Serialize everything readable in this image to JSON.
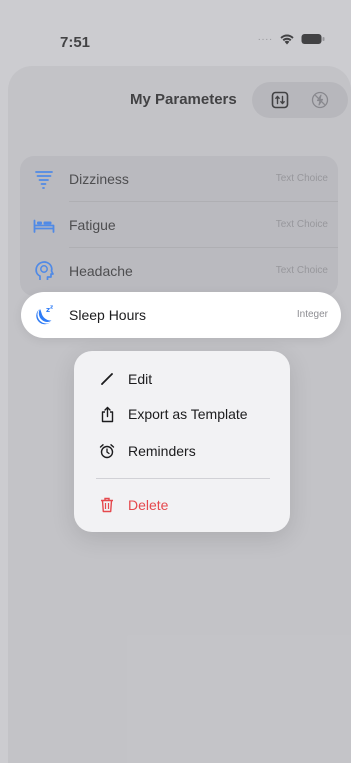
{
  "status": {
    "time": "7:51",
    "signal": "...."
  },
  "header": {
    "title": "My Parameters"
  },
  "icons": {
    "sort": "sort-icon",
    "flash_off": "flash-off-icon",
    "dizziness": "tornado-icon",
    "fatigue": "bed-icon",
    "headache": "head-icon",
    "sleep": "moon-zzz-icon"
  },
  "parameters": [
    {
      "label": "Dizziness",
      "type": "Text Choice"
    },
    {
      "label": "Fatigue",
      "type": "Text Choice"
    },
    {
      "label": "Headache",
      "type": "Text Choice"
    }
  ],
  "selected": {
    "label": "Sleep Hours",
    "type": "Integer"
  },
  "menu": {
    "edit": "Edit",
    "export": "Export as Template",
    "reminders": "Reminders",
    "delete": "Delete"
  },
  "colors": {
    "accent": "#2f7cf6",
    "danger": "#e5484d"
  }
}
